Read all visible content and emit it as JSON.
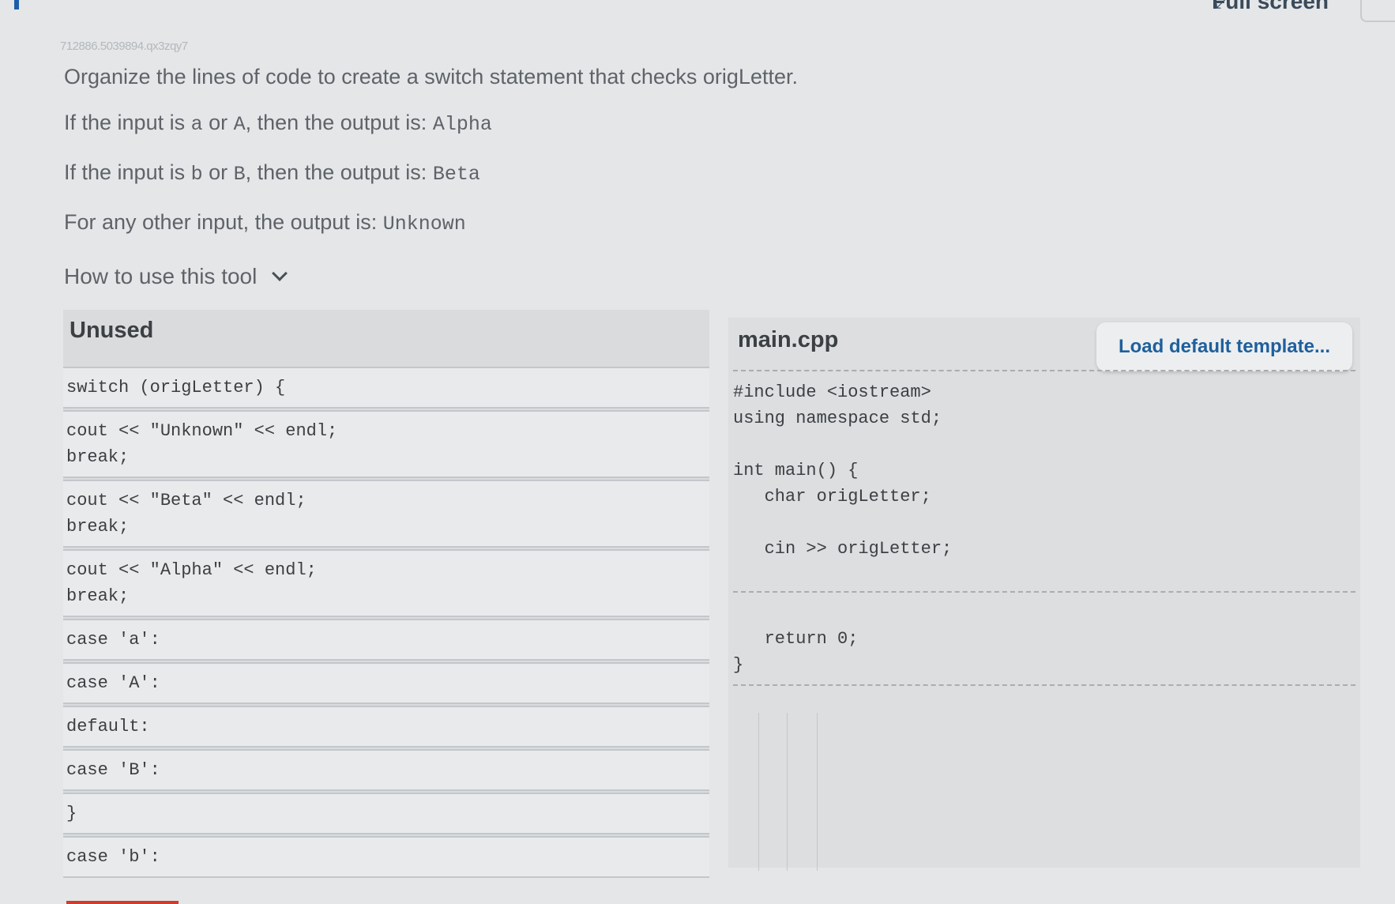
{
  "header": {
    "activity_id": "712886.5039894.qx3zqy7",
    "fullscreen_label": "Full screen"
  },
  "prompt": {
    "line1": "Organize the lines of code to create a switch statement that checks origLetter.",
    "line2": {
      "pre": "If the input is ",
      "a": "a",
      "or": " or ",
      "b": "A",
      "mid": ", then the output is: ",
      "out": "Alpha"
    },
    "line3": {
      "pre": "If the input is ",
      "a": "b",
      "or": " or ",
      "b": "B",
      "mid": ", then the output is: ",
      "out": "Beta"
    },
    "line4": {
      "pre": "For any other input, the output is: ",
      "out": "Unknown"
    }
  },
  "how_to": {
    "label": "How to use this tool",
    "icon": "chevron-down-icon"
  },
  "unused": {
    "title": "Unused",
    "blocks": [
      [
        "switch (origLetter) {"
      ],
      [
        "cout << \"Unknown\" << endl;",
        "break;"
      ],
      [
        "cout << \"Beta\" << endl;",
        "break;"
      ],
      [
        "cout << \"Alpha\" << endl;",
        "break;"
      ],
      [
        "case 'a':"
      ],
      [
        "case 'A':"
      ],
      [
        "default:"
      ],
      [
        "case 'B':"
      ],
      [
        "}"
      ],
      [
        "case 'b':"
      ]
    ]
  },
  "main_cpp": {
    "title": "main.cpp",
    "load_button": "Load default template...",
    "code_top": [
      "#include <iostream>",
      "using namespace std;",
      "",
      "int main() {",
      "   char origLetter;",
      "",
      "   cin >> origLetter;"
    ],
    "code_bottom": [
      "   return 0;",
      "}"
    ]
  },
  "colors": {
    "background": "#e4e6e8",
    "panel": "#dcdee0",
    "button_text": "#1f5f9c",
    "accent_bar": "#d23b2b"
  }
}
